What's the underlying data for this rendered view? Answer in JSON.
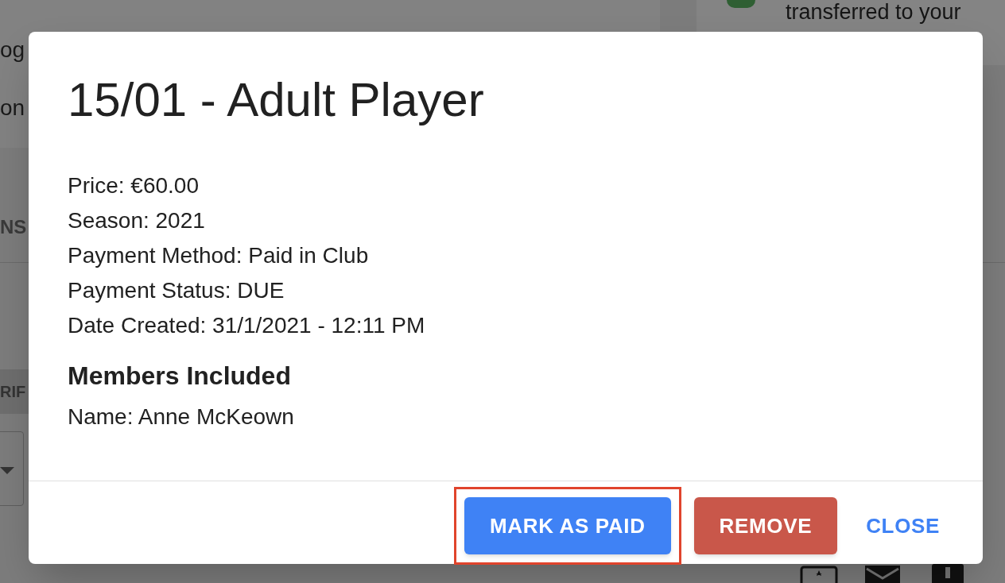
{
  "background": {
    "side_texts": [
      "og",
      "on"
    ],
    "tab_label": "NS",
    "section_label": "RIF",
    "notification": {
      "text": "transferred to your"
    }
  },
  "dialog": {
    "title": "15/01 - Adult Player",
    "details": [
      "Price: €60.00",
      "Season: 2021",
      "Payment Method: Paid in Club",
      "Payment Status: DUE",
      "Date Created: 31/1/2021 - 12:11 PM"
    ],
    "members_heading": "Members Included",
    "members": [
      "Name: Anne McKeown"
    ],
    "actions": [
      {
        "label": "MARK AS PAID",
        "kind": "primary",
        "highlighted": true
      },
      {
        "label": "REMOVE",
        "kind": "danger",
        "highlighted": false
      },
      {
        "label": "CLOSE",
        "kind": "text",
        "highlighted": false
      }
    ]
  }
}
